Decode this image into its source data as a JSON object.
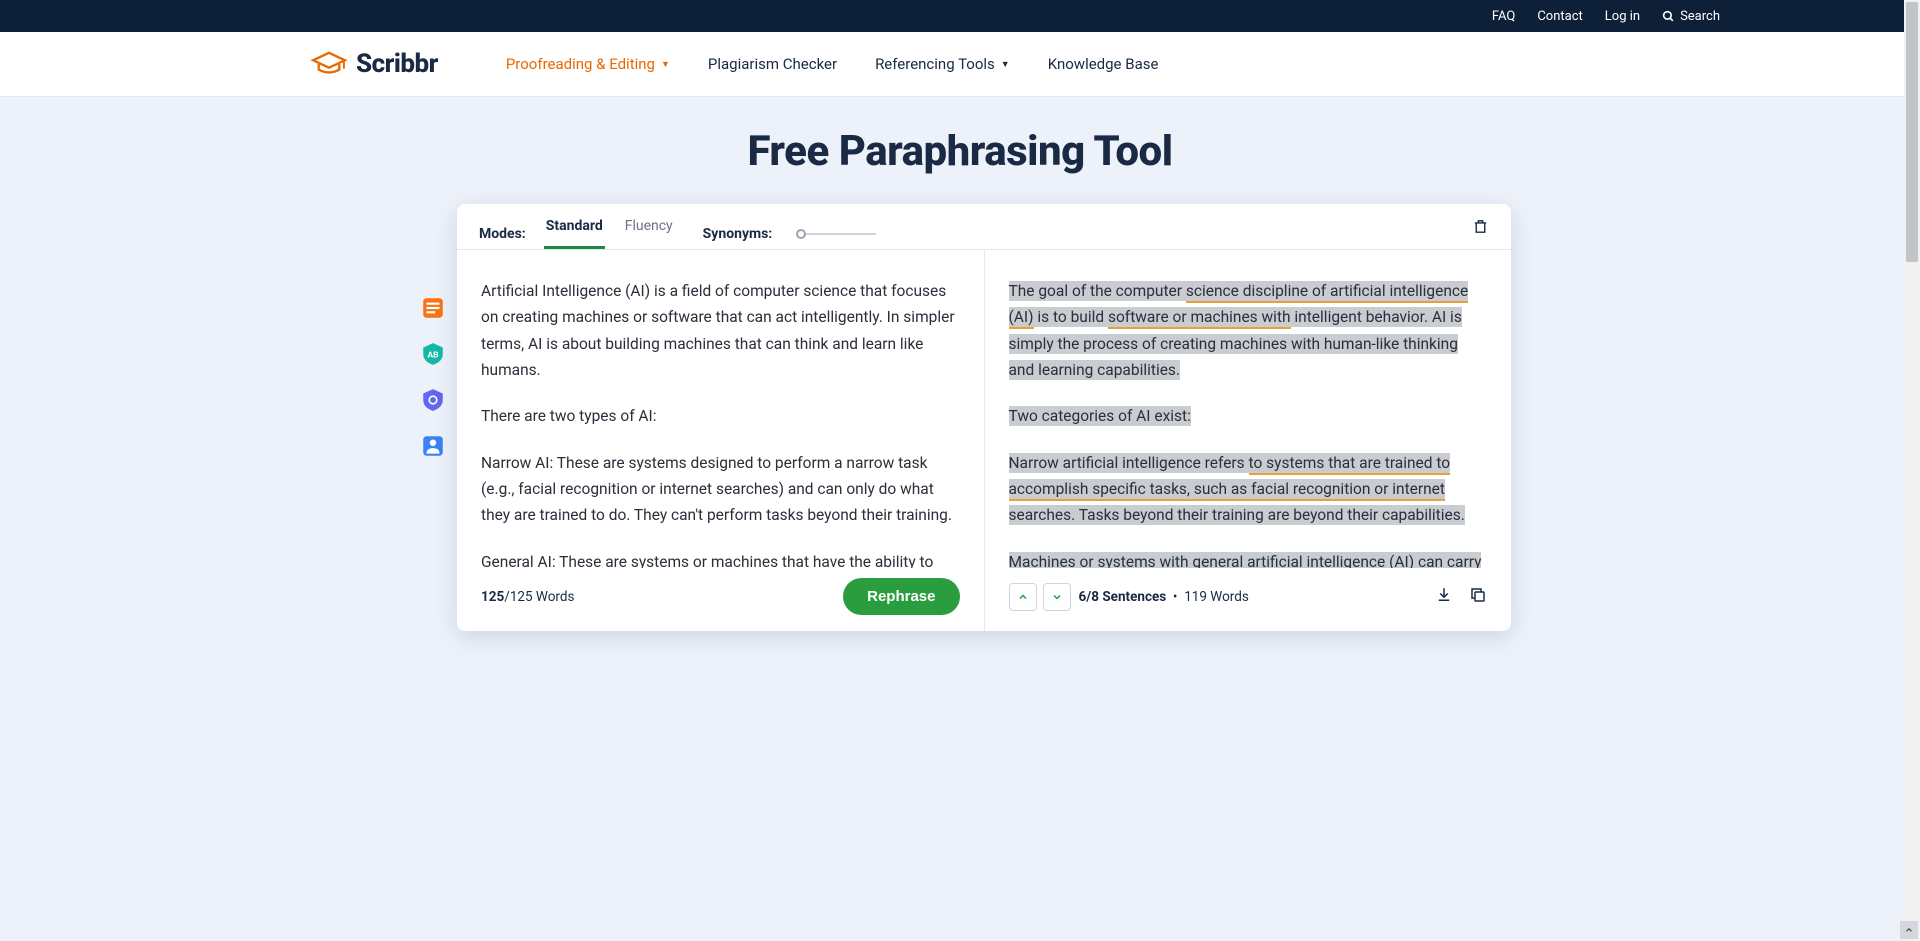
{
  "topbar": {
    "faq": "FAQ",
    "contact": "Contact",
    "login": "Log in",
    "search": "Search"
  },
  "nav": {
    "brand": "Scribbr",
    "items": [
      {
        "label": "Proofreading & Editing",
        "dropdown": true,
        "active": true
      },
      {
        "label": "Plagiarism Checker",
        "dropdown": false,
        "active": false
      },
      {
        "label": "Referencing Tools",
        "dropdown": true,
        "active": false
      },
      {
        "label": "Knowledge Base",
        "dropdown": false,
        "active": false
      }
    ]
  },
  "page": {
    "title": "Free Paraphrasing Tool"
  },
  "modes": {
    "label": "Modes:",
    "tabs": [
      "Standard",
      "Fluency"
    ],
    "selected": "Standard",
    "synonyms_label": "Synonyms:"
  },
  "input": {
    "p1": "Artificial Intelligence (AI) is a field of computer science that focuses on creating machines or software that can act intelligently. In simpler terms, AI is about building machines that can think and learn like humans.",
    "p2": "There are two types of AI:",
    "p3": "Narrow AI: These are systems designed to perform a narrow task (e.g., facial recognition or internet searches) and can only do what they are trained to do. They can't perform tasks beyond their training.",
    "p4": "General AI: These are systems or machines that have the ability to perform",
    "word_count_current": "125",
    "word_count_total": "/125 Words",
    "rephrase": "Rephrase"
  },
  "output": {
    "s1a": "The goal of the computer ",
    "s1b": "science discipline of artificial intelligence (AI)",
    "s1c": " is to build ",
    "s1d": "software or machines with",
    "s1e": " intelligent behavior. AI is simply the process of creating machines with human-like thinking and learning capabilities.",
    "s2": "Two categories of AI exist:",
    "s3a": "Narrow artificial intelligence refers ",
    "s3b": "to systems that are trained to accomplish specific tasks, such as",
    "s3c": " facial recognition",
    "s3d": " or internet",
    "s3e": " searches. Tasks beyond their training are beyond their capabilities.",
    "s4a": "Machines or systems",
    "s4b": " with general artificial intelligence (AI) ",
    "s4c": "can carry out any",
    "sentence_counter": "6/8 Sentences",
    "bullet": "•",
    "word_count": "119 Words"
  },
  "colors": {
    "accent_orange": "#e86902",
    "accent_green": "#2a9d3f",
    "topbar_bg": "#0d2038",
    "page_bg": "#edf2fa"
  }
}
